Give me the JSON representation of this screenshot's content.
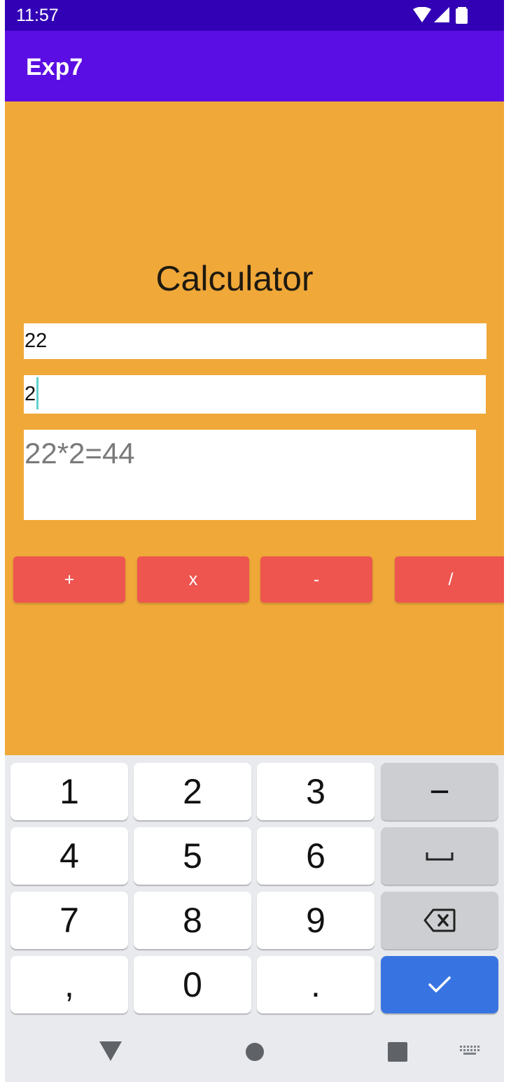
{
  "status_bar": {
    "time": "11:57",
    "icons": [
      "wifi-icon",
      "signal-icon",
      "battery-icon"
    ]
  },
  "app_bar": {
    "title": "Exp7"
  },
  "main": {
    "title": "Calculator",
    "input1_value": "22",
    "input2_value": "2",
    "result_text": "22*2=44",
    "buttons": {
      "add": "+",
      "multiply": "x",
      "subtract": "-",
      "divide": "/"
    }
  },
  "keyboard": {
    "rows": [
      [
        "1",
        "2",
        "3",
        "−"
      ],
      [
        "4",
        "5",
        "6",
        "space-icon"
      ],
      [
        "7",
        "8",
        "9",
        "backspace-icon"
      ],
      [
        ",",
        "0",
        ".",
        "check-icon"
      ]
    ]
  },
  "nav_bar": {
    "icons": [
      "back-icon",
      "home-icon",
      "recents-icon",
      "keyboard-switch-icon"
    ]
  },
  "colors": {
    "status_bar": "#3200b5",
    "app_bar": "#5b0ee3",
    "background": "#f0a839",
    "button": "#ee554f",
    "keyboard_done": "#3874e1",
    "caret": "#5ed2cc"
  }
}
